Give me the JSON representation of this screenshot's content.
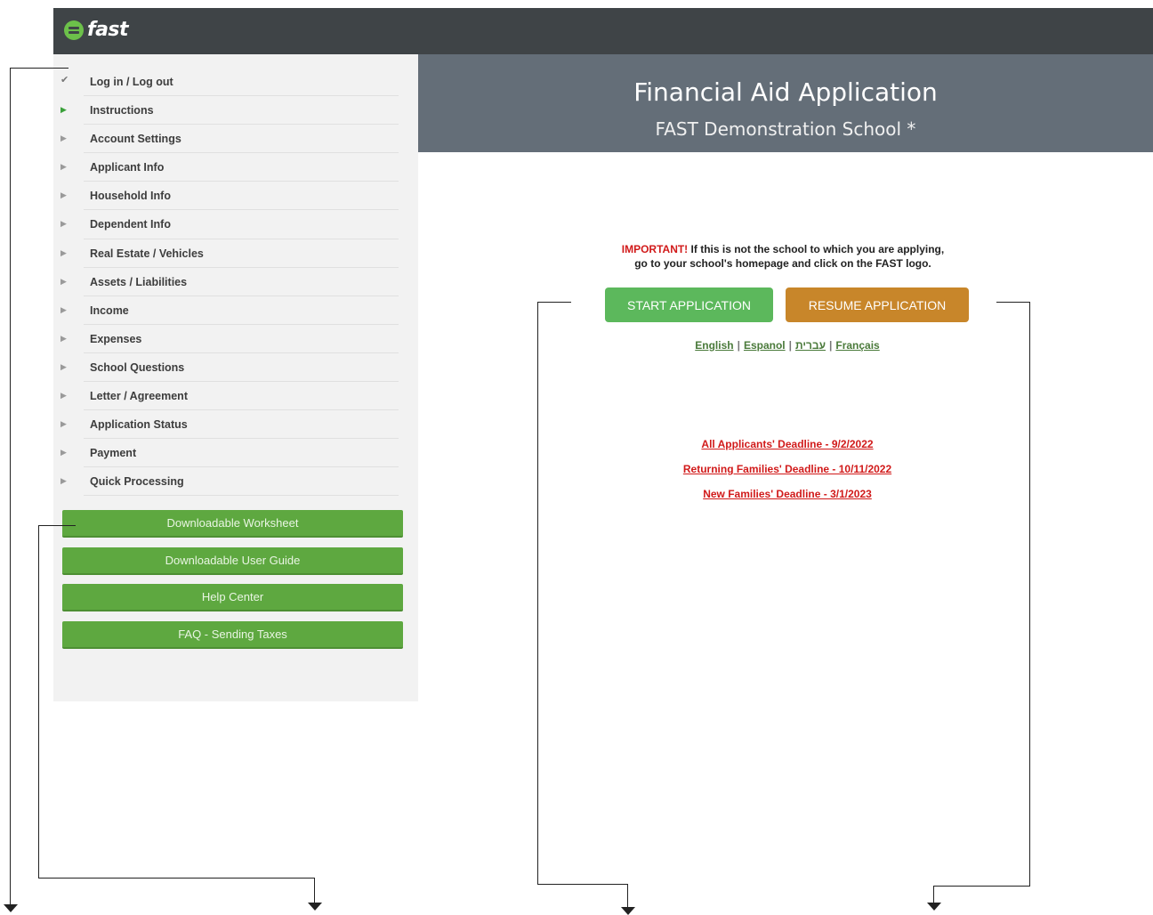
{
  "header": {
    "logo_text": "fast",
    "logo_icon": "fast-logo-icon"
  },
  "sidebar": {
    "items": [
      {
        "label": "Log in / Log out",
        "status": "complete"
      },
      {
        "label": "Instructions",
        "status": "current"
      },
      {
        "label": "Account Settings",
        "status": "pending"
      },
      {
        "label": "Applicant Info",
        "status": "pending"
      },
      {
        "label": "Household Info",
        "status": "pending"
      },
      {
        "label": "Dependent Info",
        "status": "pending"
      },
      {
        "label": "Real Estate / Vehicles",
        "status": "pending"
      },
      {
        "label": "Assets / Liabilities",
        "status": "pending"
      },
      {
        "label": "Income",
        "status": "pending"
      },
      {
        "label": "Expenses",
        "status": "pending"
      },
      {
        "label": "School Questions",
        "status": "pending"
      },
      {
        "label": "Letter / Agreement",
        "status": "pending"
      },
      {
        "label": "Application Status",
        "status": "pending"
      },
      {
        "label": "Payment",
        "status": "pending"
      },
      {
        "label": "Quick Processing",
        "status": "pending"
      }
    ],
    "buttons": [
      {
        "label": "Downloadable Worksheet"
      },
      {
        "label": "Downloadable User Guide"
      },
      {
        "label": "Help Center"
      },
      {
        "label": "FAQ - Sending Taxes"
      }
    ]
  },
  "banner": {
    "title": "Financial Aid Application",
    "subtitle": "FAST Demonstration School *"
  },
  "notice": {
    "warning": "IMPORTANT!",
    "line1": "If this is not the school to which you are applying,",
    "line2": "go to your school's homepage and click on the FAST logo."
  },
  "actions": {
    "start_label": "START APPLICATION",
    "resume_label": "RESUME APPLICATION"
  },
  "languages": [
    "English",
    "Espanol",
    "עברית",
    "Français"
  ],
  "deadlines": [
    "All Applicants' Deadline - 9/2/2022",
    "Returning Families' Deadline - 10/11/2022",
    "New Families' Deadline - 3/1/2023"
  ],
  "colors": {
    "topbar": "#3f4447",
    "banner": "#646e78",
    "sidebar_bg": "#f2f2f2",
    "sidebar_button": "#5ea840",
    "start_button": "#5cb85c",
    "resume_button": "#c8862a",
    "warning_red": "#d11a1a",
    "logo_green": "#6cc04a"
  }
}
